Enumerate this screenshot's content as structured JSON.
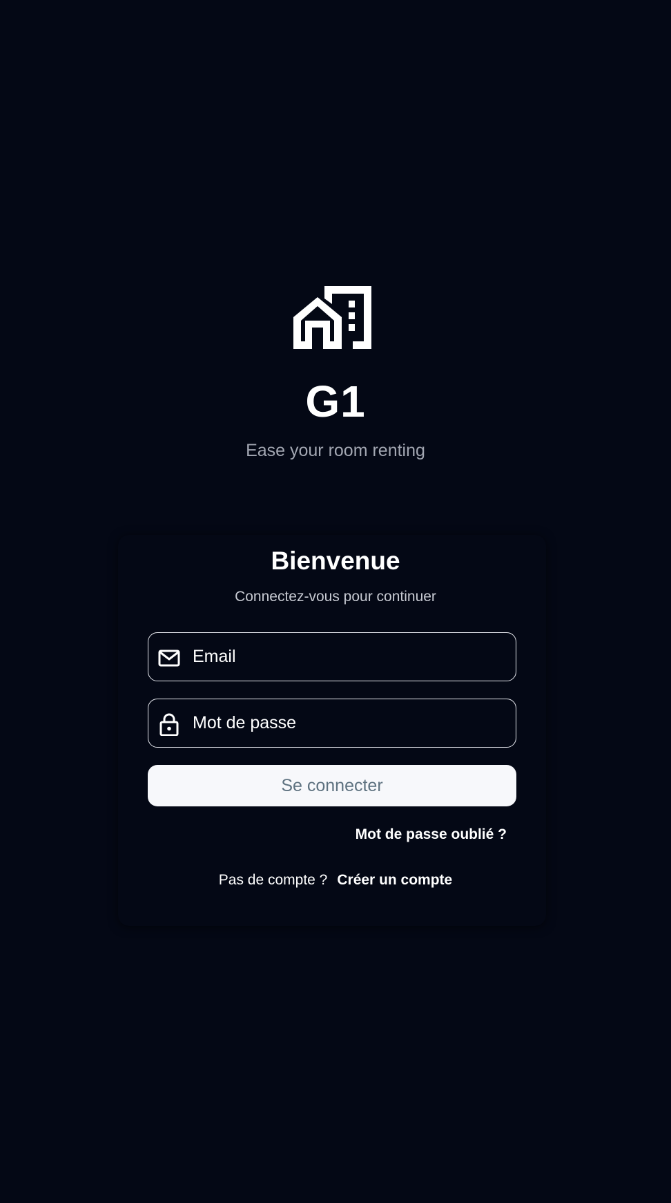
{
  "brand": {
    "logo_icon": "house-building-icon",
    "app_name": "G1",
    "tagline": "Ease your room renting"
  },
  "login": {
    "title": "Bienvenue",
    "subtitle": "Connectez-vous pour continuer",
    "email": {
      "icon": "mail-icon",
      "placeholder": "Email",
      "value": ""
    },
    "password": {
      "icon": "lock-icon",
      "placeholder": "Mot de passe",
      "value": ""
    },
    "submit_label": "Se connecter",
    "forgot_password": "Mot de passe oublié ?",
    "no_account": "Pas de compte ?",
    "create_account": "Créer un compte"
  },
  "colors": {
    "background": "#040815",
    "text": "#ffffff",
    "muted_text": "#a3a7b2",
    "button_bg": "#f7f8fb",
    "button_text": "#5e7280",
    "field_border": "#e6e8ee"
  }
}
